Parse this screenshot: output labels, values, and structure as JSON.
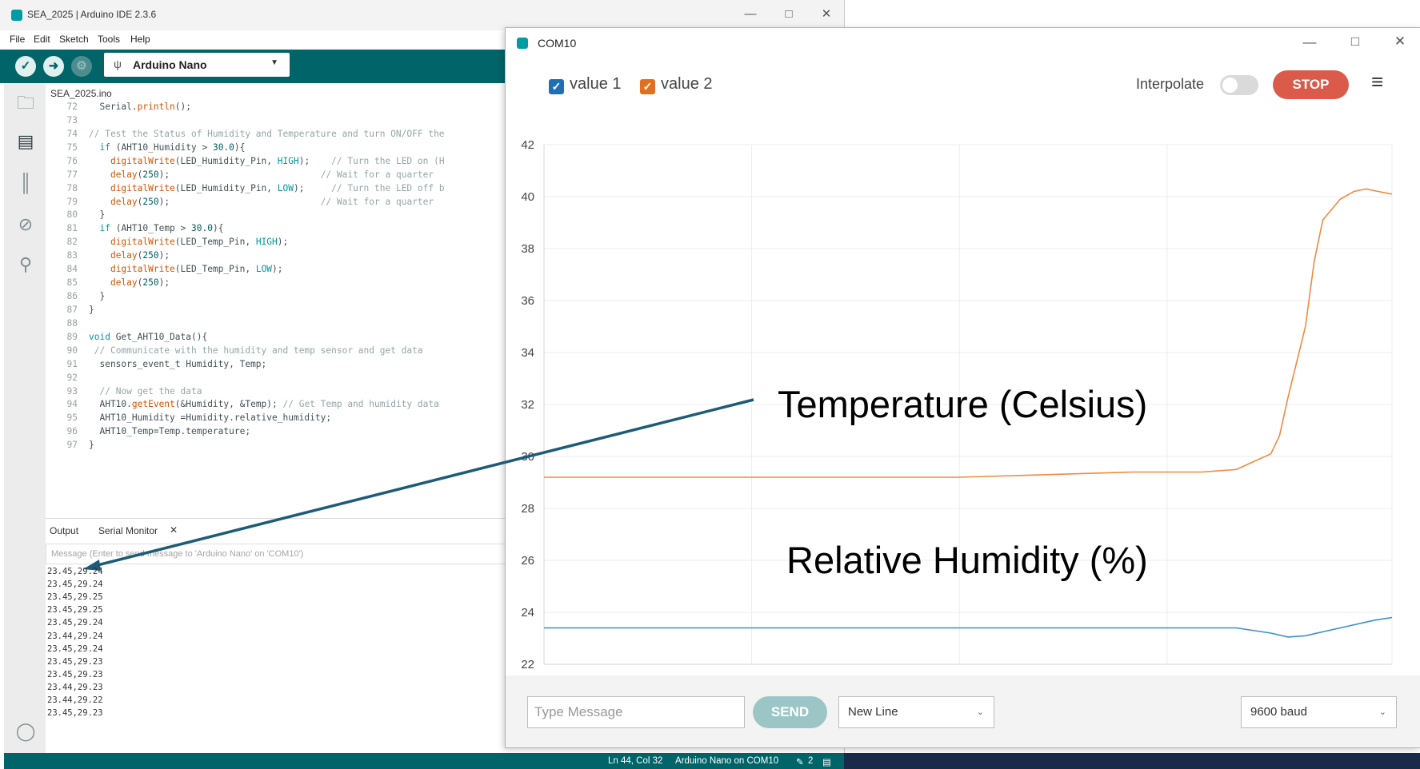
{
  "ide": {
    "title": "SEA_2025 | Arduino IDE 2.3.6",
    "menu": [
      "File",
      "Edit",
      "Sketch",
      "Tools",
      "Help"
    ],
    "board": "Arduino Nano",
    "file_tab": "SEA_2025.ino",
    "panel_tabs": {
      "output": "Output",
      "serial_monitor": "Serial Monitor"
    },
    "message_placeholder": "Message (Enter to send message to 'Arduino Nano' on 'COM10')",
    "serial_output": [
      "23.45,29.24",
      "23.45,29.24",
      "23.45,29.25",
      "23.45,29.25",
      "23.45,29.24",
      "23.44,29.24",
      "23.45,29.24",
      "23.45,29.23",
      "23.45,29.23",
      "23.44,29.23",
      "23.44,29.22",
      "23.45,29.23"
    ],
    "status": {
      "position": "Ln 44, Col 32",
      "board_port": "Arduino Nano on COM10",
      "notifications": "2"
    }
  },
  "code_lines": [
    {
      "n": "72",
      "t": "  Serial.println();"
    },
    {
      "n": "73",
      "t": ""
    },
    {
      "n": "74",
      "t": "// Test the Status of Humidity and Temperature and turn ON/OFF the"
    },
    {
      "n": "75",
      "t": "  if (AHT10_Humidity > 30.0){"
    },
    {
      "n": "76",
      "t": "    digitalWrite(LED_Humidity_Pin, HIGH);    // Turn the LED on (H"
    },
    {
      "n": "77",
      "t": "    delay(250);                            // Wait for a quarter"
    },
    {
      "n": "78",
      "t": "    digitalWrite(LED_Humidity_Pin, LOW);     // Turn the LED off b"
    },
    {
      "n": "79",
      "t": "    delay(250);                            // Wait for a quarter"
    },
    {
      "n": "80",
      "t": "  }"
    },
    {
      "n": "81",
      "t": "  if (AHT10_Temp > 30.0){"
    },
    {
      "n": "82",
      "t": "    digitalWrite(LED_Temp_Pin, HIGH);"
    },
    {
      "n": "83",
      "t": "    delay(250);"
    },
    {
      "n": "84",
      "t": "    digitalWrite(LED_Temp_Pin, LOW);"
    },
    {
      "n": "85",
      "t": "    delay(250);"
    },
    {
      "n": "86",
      "t": "  }"
    },
    {
      "n": "87",
      "t": "}"
    },
    {
      "n": "88",
      "t": ""
    },
    {
      "n": "89",
      "t": "void Get_AHT10_Data(){"
    },
    {
      "n": "90",
      "t": " // Communicate with the humidity and temp sensor and get data"
    },
    {
      "n": "91",
      "t": "  sensors_event_t Humidity, Temp;"
    },
    {
      "n": "92",
      "t": ""
    },
    {
      "n": "93",
      "t": "  // Now get the data"
    },
    {
      "n": "94",
      "t": "  AHT10.getEvent(&Humidity, &Temp); // Get Temp and humidity data"
    },
    {
      "n": "95",
      "t": "  AHT10_Humidity =Humidity.relative_humidity;"
    },
    {
      "n": "96",
      "t": "  AHT10_Temp=Temp.temperature;"
    },
    {
      "n": "97",
      "t": "}"
    }
  ],
  "plotter": {
    "title": "COM10",
    "interpolate_label": "Interpolate",
    "stop_label": "STOP",
    "type_message_placeholder": "Type Message",
    "send_label": "SEND",
    "line_ending": "New Line",
    "baud": "9600 baud"
  },
  "colors": {
    "accent": "#006468",
    "series1": "#3b8fd1",
    "series2": "#f08a41",
    "stop": "#da5b4a"
  },
  "chart_data": {
    "type": "line",
    "series": [
      {
        "name": "value 1",
        "color": "#3b8fd1",
        "x": [
          136,
          140,
          145,
          150,
          155,
          160,
          165,
          170,
          176,
          178,
          179,
          180,
          182,
          184,
          185
        ],
        "y": [
          23.4,
          23.4,
          23.4,
          23.4,
          23.4,
          23.4,
          23.4,
          23.4,
          23.4,
          23.2,
          23.05,
          23.1,
          23.4,
          23.7,
          23.8
        ]
      },
      {
        "name": "value 2",
        "color": "#f08a41",
        "x": [
          136,
          140,
          145,
          150,
          155,
          160,
          165,
          170,
          174,
          176,
          177,
          178,
          178.5,
          179,
          180,
          180.5,
          181,
          182,
          182.8,
          183.5,
          184.2,
          185
        ],
        "y": [
          29.2,
          29.2,
          29.2,
          29.2,
          29.2,
          29.2,
          29.3,
          29.4,
          29.4,
          29.5,
          29.8,
          30.1,
          30.8,
          32.3,
          35,
          37.5,
          39.1,
          39.9,
          40.2,
          40.3,
          40.2,
          40.1
        ]
      }
    ],
    "x_ticks": [
      136,
      148,
      160,
      172,
      185
    ],
    "y_ticks": [
      22,
      24,
      26,
      28,
      30,
      32,
      34,
      36,
      38,
      40,
      42
    ],
    "xlim": [
      136,
      185
    ],
    "ylim": [
      22,
      42
    ],
    "grid": true
  },
  "annotations": {
    "temperature": "Temperature (Celsius)",
    "humidity": "Relative Humidity (%)"
  }
}
